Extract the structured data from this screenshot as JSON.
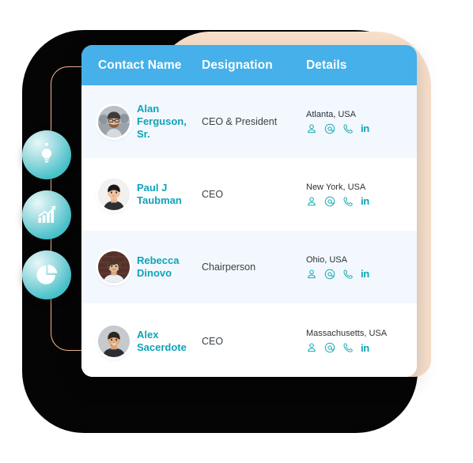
{
  "theme": {
    "header_blue": "#45b0e9",
    "accent_teal": "#0fa3b8",
    "peach": "#f7dfcb",
    "connector_orange": "#f0b48a",
    "row_alt": "#f2f8fd",
    "backdrop_dark": "#050505"
  },
  "table": {
    "columns": [
      {
        "key": "name",
        "label": "Contact Name"
      },
      {
        "key": "desig",
        "label": "Designation"
      },
      {
        "key": "details",
        "label": "Details"
      }
    ],
    "rows": [
      {
        "name": "Alan\nFerguson, Sr.",
        "name_line1": "Alan",
        "name_line2": "Ferguson, Sr.",
        "designation": "CEO & President",
        "location": "Atlanta, USA",
        "avatar": "photo-bearded-man-glasses",
        "shade": "alt"
      },
      {
        "name": "Paul J\nTaubman",
        "name_line1": "Paul J",
        "name_line2": "Taubman",
        "designation": "CEO",
        "location": "New York, USA",
        "avatar": "photo-man-dark-shirt",
        "shade": "plain"
      },
      {
        "name": "Rebecca\nDinovo",
        "name_line1": "Rebecca",
        "name_line2": "Dinovo",
        "designation": "Chairperson",
        "location": "Ohio, USA",
        "avatar": "photo-person-brick-wall",
        "shade": "alt"
      },
      {
        "name": "Alex\nSacerdote",
        "name_line1": "Alex",
        "name_line2": "Sacerdote",
        "designation": "CEO",
        "location": "Massachusetts, USA",
        "avatar": "photo-smiling-man",
        "shade": "plain"
      }
    ],
    "detail_icons": [
      {
        "name": "contact-person-icon",
        "glyph": "person"
      },
      {
        "name": "email-icon",
        "glyph": "at"
      },
      {
        "name": "phone-icon",
        "glyph": "phone"
      },
      {
        "name": "linkedin-icon",
        "glyph": "in",
        "label": "in"
      }
    ]
  },
  "rail": {
    "items": [
      {
        "name": "idea-lightbulb-icon",
        "glyph": "lightbulb"
      },
      {
        "name": "growth-chart-icon",
        "glyph": "bar-chart-arrow"
      },
      {
        "name": "pie-chart-icon",
        "glyph": "pie-chart"
      }
    ]
  }
}
